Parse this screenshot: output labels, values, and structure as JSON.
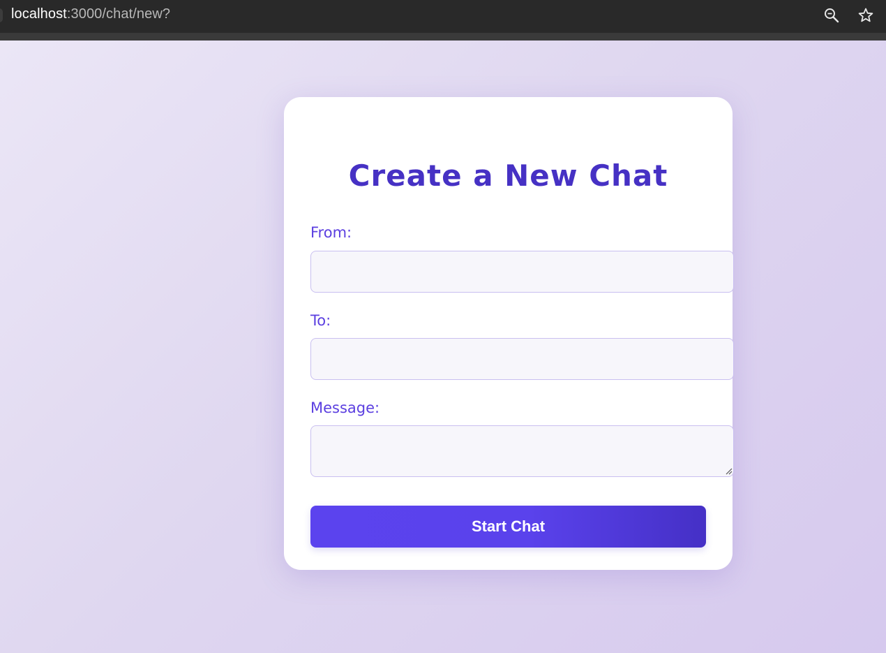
{
  "browser": {
    "url_host": "localhost",
    "url_path": ":3000/chat/new?",
    "icons": [
      "zoom-icon",
      "star-icon"
    ]
  },
  "form": {
    "title": "Create a New Chat",
    "from_label": "From:",
    "from_value": "",
    "to_label": "To:",
    "to_value": "",
    "message_label": "Message:",
    "message_value": "",
    "submit_label": "Start Chat"
  },
  "colors": {
    "accent": "#5b43ee",
    "title": "#4631c4",
    "label": "#5b3fe0",
    "input_bg": "#f7f6fb",
    "input_border": "#c9bff0"
  }
}
